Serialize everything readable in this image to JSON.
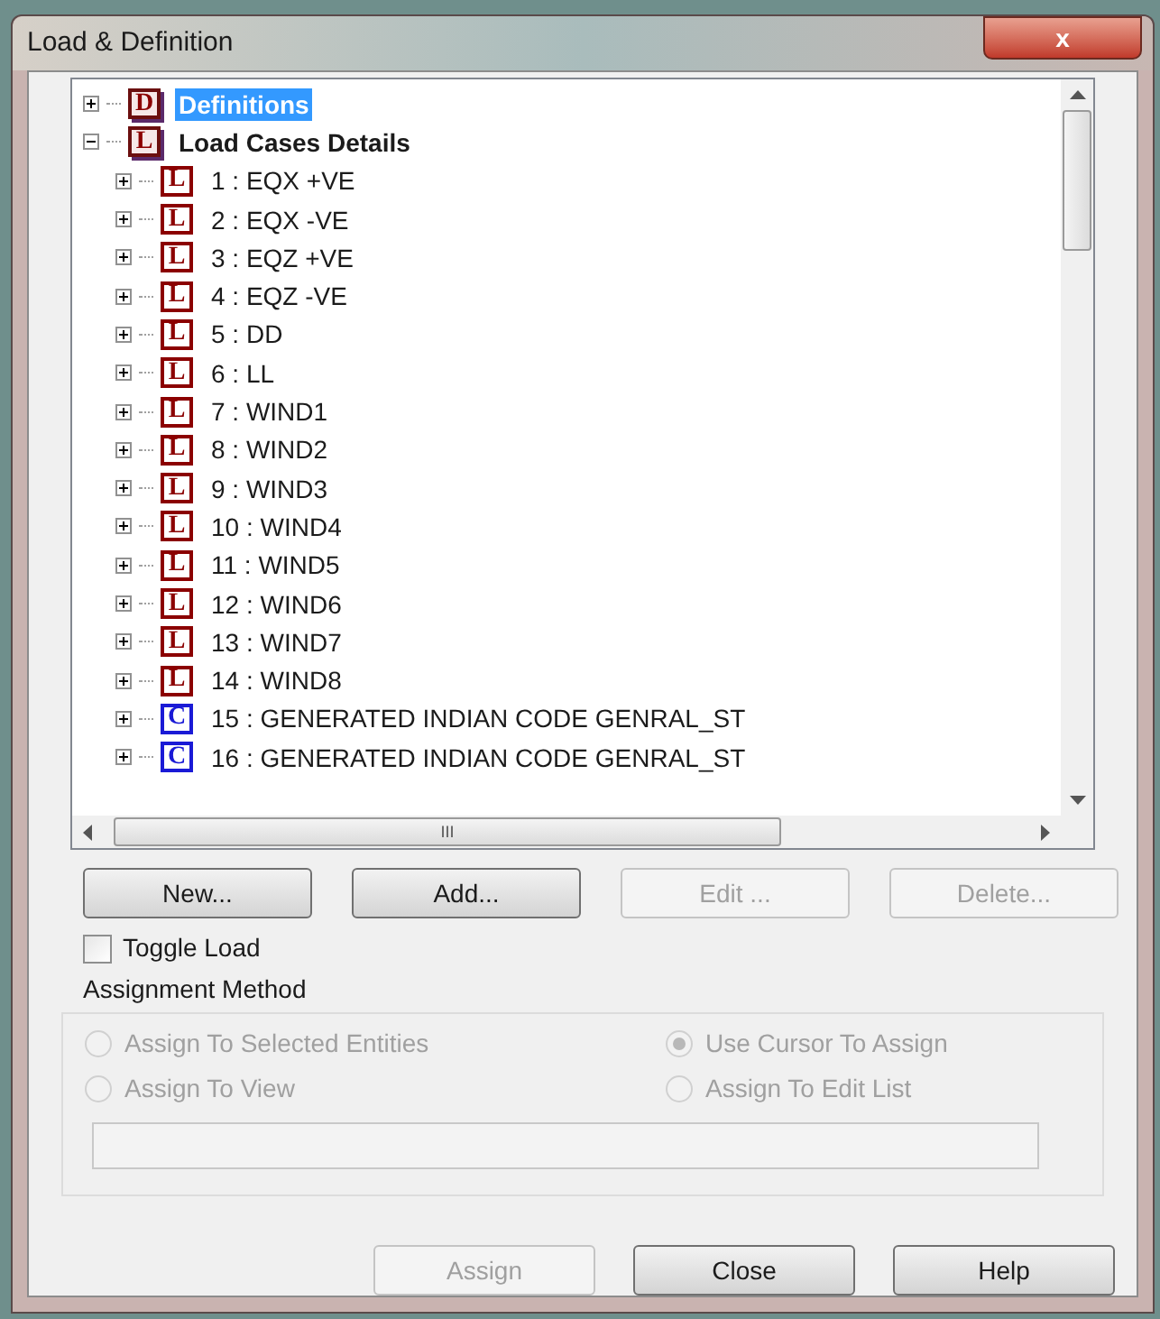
{
  "window": {
    "title": "Load & Definition",
    "close_glyph": "x"
  },
  "tree": [
    {
      "badge": "D",
      "kind": "root",
      "label": "Definitions",
      "selected": true,
      "expanded": false
    },
    {
      "badge": "L",
      "kind": "root",
      "label": "Load Cases Details",
      "selected": false,
      "expanded": true,
      "children": [
        {
          "badge": "L",
          "kind": "primary",
          "label": "1 : EQX +VE",
          "selected": false,
          "expanded": false
        },
        {
          "badge": "L",
          "kind": "primary",
          "label": "2 : EQX -VE",
          "selected": false,
          "expanded": false
        },
        {
          "badge": "L",
          "kind": "primary",
          "label": "3 : EQZ +VE",
          "selected": false,
          "expanded": false
        },
        {
          "badge": "L",
          "kind": "primary",
          "label": "4 : EQZ -VE",
          "selected": false,
          "expanded": false
        },
        {
          "badge": "L",
          "kind": "primary",
          "label": "5 : DD",
          "selected": false,
          "expanded": false
        },
        {
          "badge": "L",
          "kind": "primary",
          "label": "6 : LL",
          "selected": false,
          "expanded": false
        },
        {
          "badge": "L",
          "kind": "primary",
          "label": "7 : WIND1",
          "selected": false,
          "expanded": false
        },
        {
          "badge": "L",
          "kind": "primary",
          "label": "8 : WIND2",
          "selected": false,
          "expanded": false
        },
        {
          "badge": "L",
          "kind": "primary",
          "label": "9 : WIND3",
          "selected": false,
          "expanded": false
        },
        {
          "badge": "L",
          "kind": "primary",
          "label": "10 : WIND4",
          "selected": false,
          "expanded": false
        },
        {
          "badge": "L",
          "kind": "primary",
          "label": "11 : WIND5",
          "selected": false,
          "expanded": false
        },
        {
          "badge": "L",
          "kind": "primary",
          "label": "12 : WIND6",
          "selected": false,
          "expanded": false
        },
        {
          "badge": "L",
          "kind": "primary",
          "label": "13 : WIND7",
          "selected": false,
          "expanded": false
        },
        {
          "badge": "L",
          "kind": "primary",
          "label": "14 : WIND8",
          "selected": false,
          "expanded": false
        },
        {
          "badge": "C",
          "kind": "combination",
          "label": "15 : GENERATED INDIAN CODE GENRAL_ST",
          "selected": false,
          "expanded": false
        },
        {
          "badge": "C",
          "kind": "combination",
          "label": "16 : GENERATED INDIAN CODE GENRAL_ST",
          "selected": false,
          "expanded": false
        }
      ]
    }
  ],
  "scroll_grip": "III",
  "buttons": [
    {
      "label": "New...",
      "disabled": false
    },
    {
      "label": "Add...",
      "disabled": false
    },
    {
      "label": "Edit ...",
      "disabled": true
    },
    {
      "label": "Delete...",
      "disabled": true
    }
  ],
  "toggle_load": {
    "label": "Toggle Load",
    "checked": false
  },
  "assignment_method": {
    "title": "Assignment Method",
    "options": [
      {
        "label": "Assign To Selected Entities",
        "selected": false,
        "disabled": true
      },
      {
        "label": "Use Cursor To Assign",
        "selected": true,
        "disabled": true
      },
      {
        "label": "Assign To View",
        "selected": false,
        "disabled": true
      },
      {
        "label": "Assign To Edit List",
        "selected": false,
        "disabled": true
      }
    ]
  },
  "footer_buttons": [
    {
      "label": "Assign",
      "disabled": true
    },
    {
      "label": "Close",
      "disabled": false
    },
    {
      "label": "Help",
      "disabled": false
    }
  ]
}
